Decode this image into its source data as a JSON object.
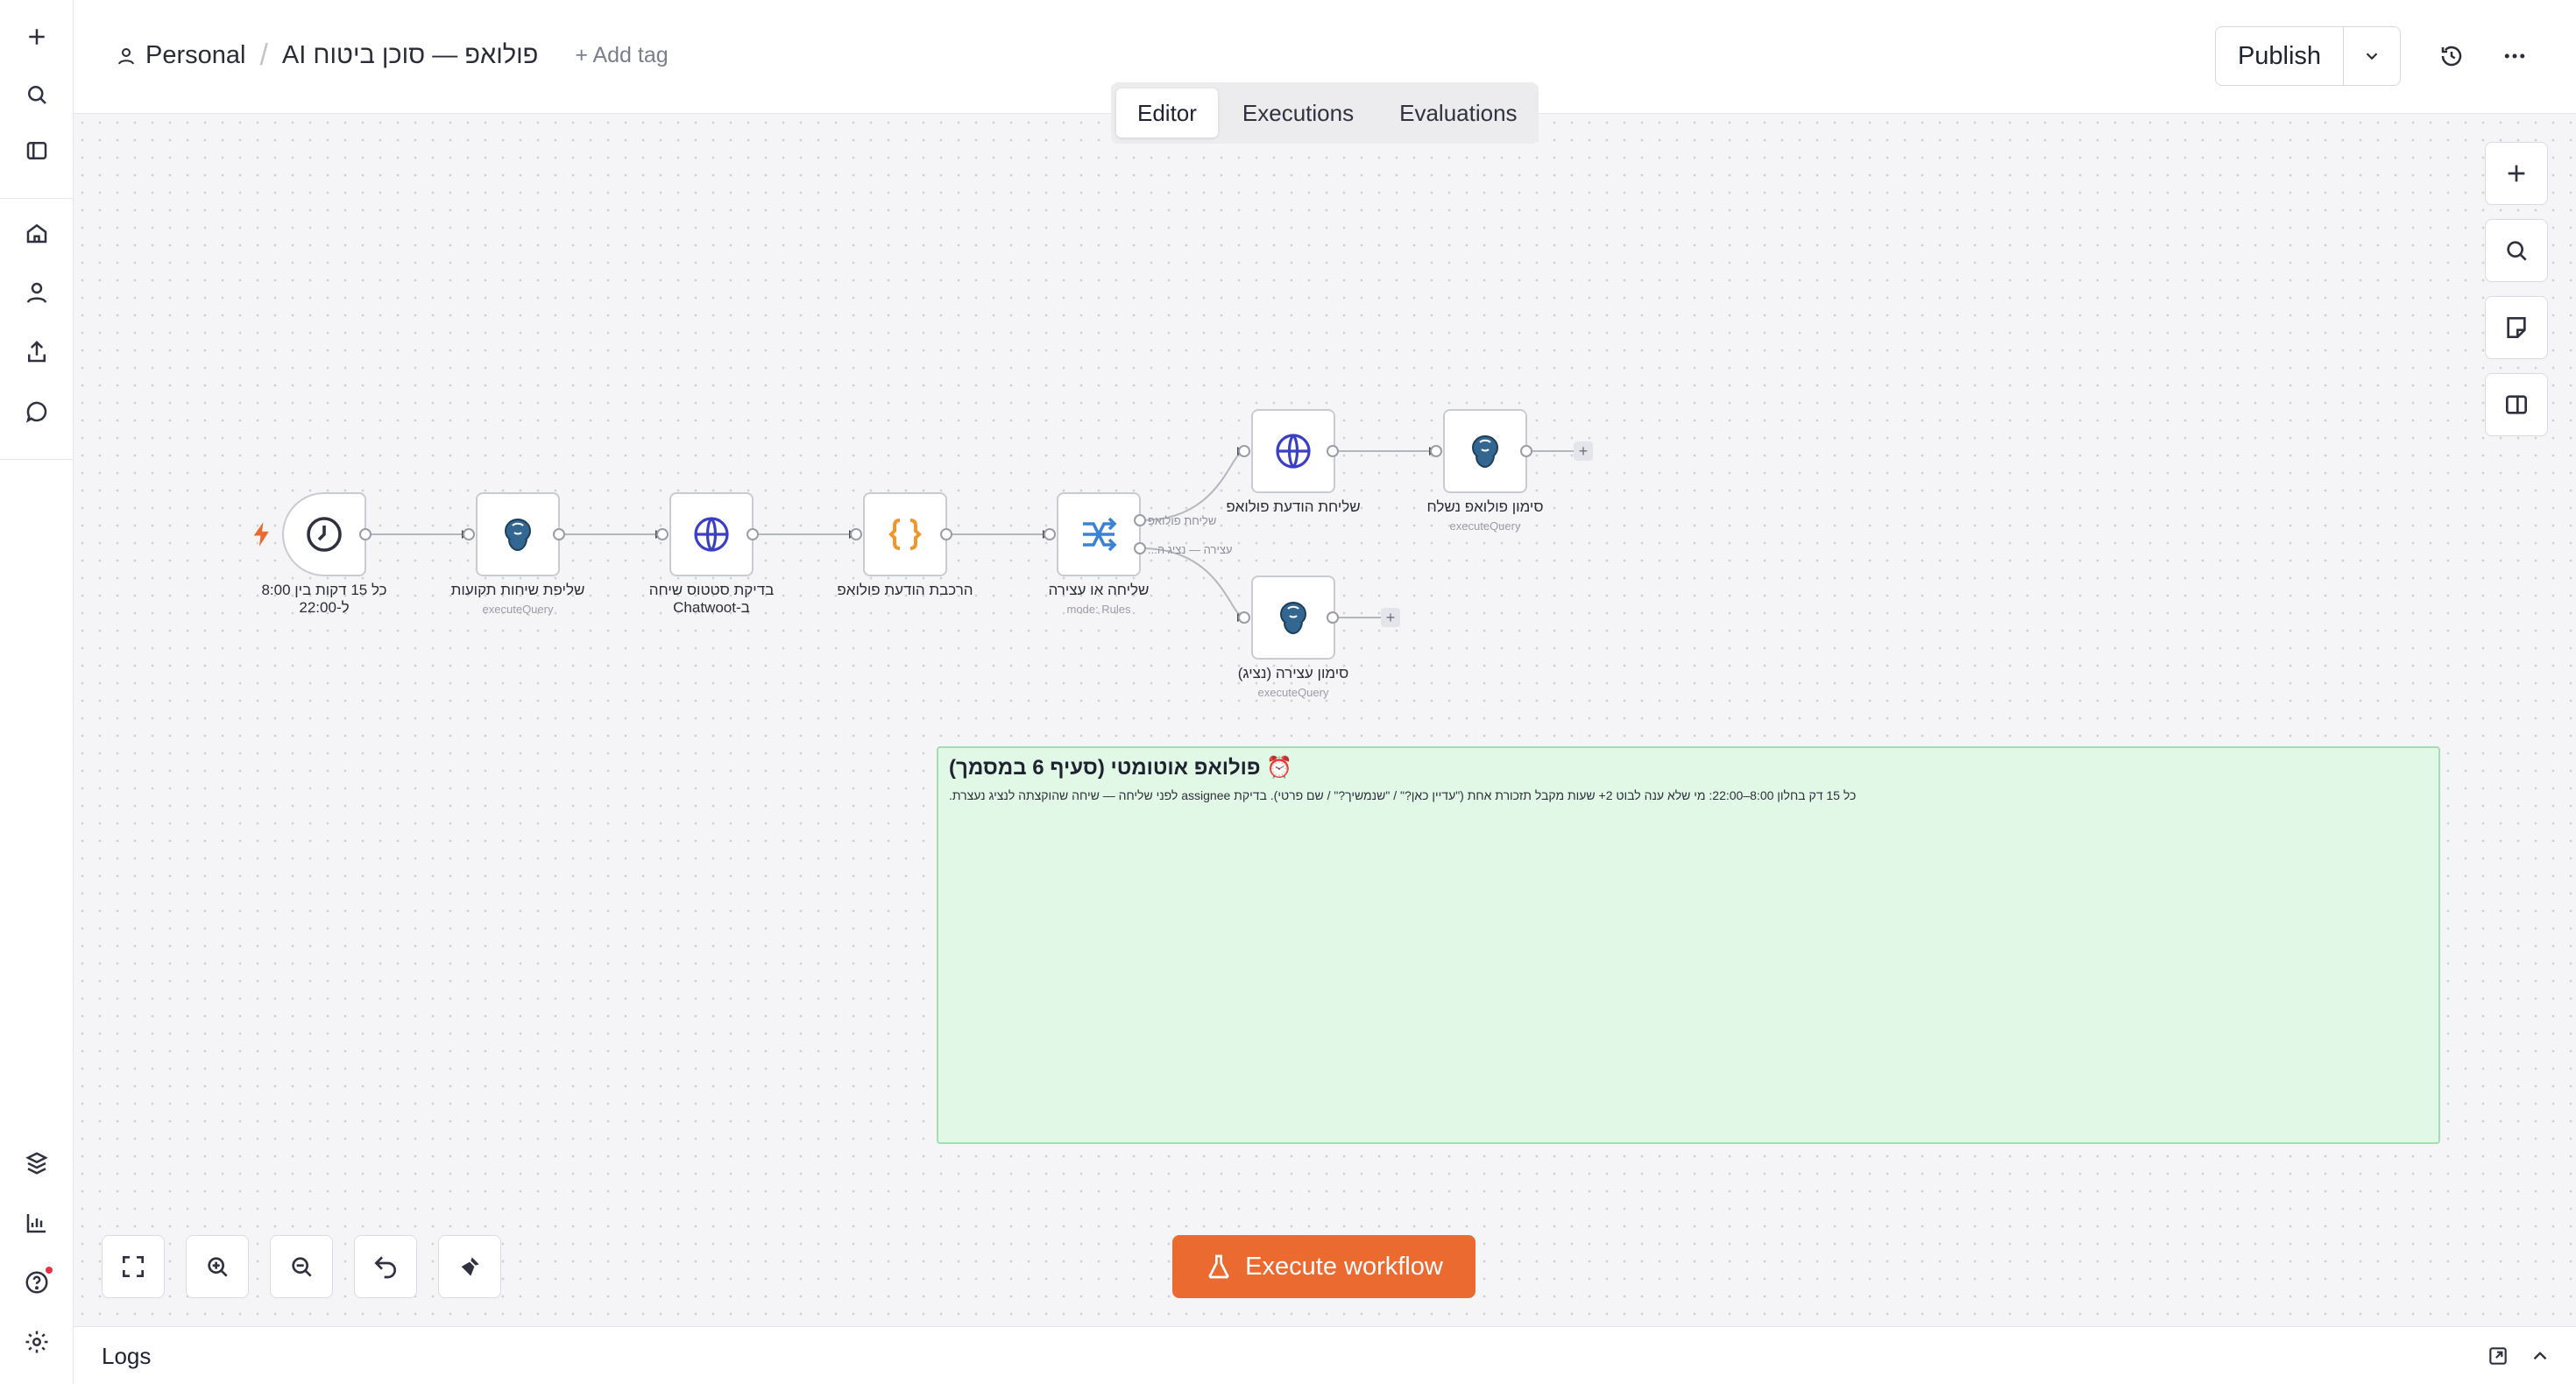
{
  "header": {
    "project": "Personal",
    "workflow_name": "פולואפ — סוכן ביטוח AI",
    "add_tag": "+ Add tag",
    "publish": "Publish"
  },
  "tabs": [
    {
      "label": "Editor",
      "active": true
    },
    {
      "label": "Executions",
      "active": false
    },
    {
      "label": "Evaluations",
      "active": false
    }
  ],
  "nodes": {
    "trigger": {
      "label_1": "כל 15 דקות בין 8:00",
      "label_2": "ל-22:00",
      "icon": "clock-icon"
    },
    "fetch": {
      "label": "שליפת שיחות תקועות",
      "sub": "executeQuery",
      "icon": "postgres-icon"
    },
    "check": {
      "label_1": "בדיקת סטטוס שיחה",
      "label_2": "ב-Chatwoot",
      "icon": "globe-icon"
    },
    "compose": {
      "label": "הרכבת הודעת פולואפ",
      "icon": "code-braces-icon"
    },
    "router": {
      "label": "שליחה או עצירה",
      "sub": "mode: Rules",
      "out_1": "שליחת פולואפ",
      "out_2": "עצירה — נציג ה...",
      "icon": "switch-icon"
    },
    "send": {
      "label": "שליחת הודעת פולואפ",
      "icon": "globe-icon"
    },
    "mark_sent": {
      "label": "סימון פולואפ נשלח",
      "sub": "executeQuery",
      "icon": "postgres-icon"
    },
    "mark_stop": {
      "label": "סימון עצירה (נציג)",
      "sub": "executeQuery",
      "icon": "postgres-icon"
    }
  },
  "sticky": {
    "title": "⏰ פולואפ אוטומטי (סעיף 6 במסמך)",
    "body": "כל 15 דק בחלון 8:00–22:00: מי שלא ענה לבוט 2+ שעות מקבל תזכורת אחת (\"עדיין כאן?\" / \"שנמשיך?\" / שם פרטי). בדיקת assignee לפני שליחה — שיחה שהוקצתה לנציג נעצרת."
  },
  "execute_button": "Execute workflow",
  "logs": {
    "label": "Logs"
  },
  "colors": {
    "accent": "#ea6a2f",
    "sticky_bg": "#e2f8e7",
    "sticky_border": "#a5dcb2",
    "trigger_bolt": "#ea6a2f"
  }
}
